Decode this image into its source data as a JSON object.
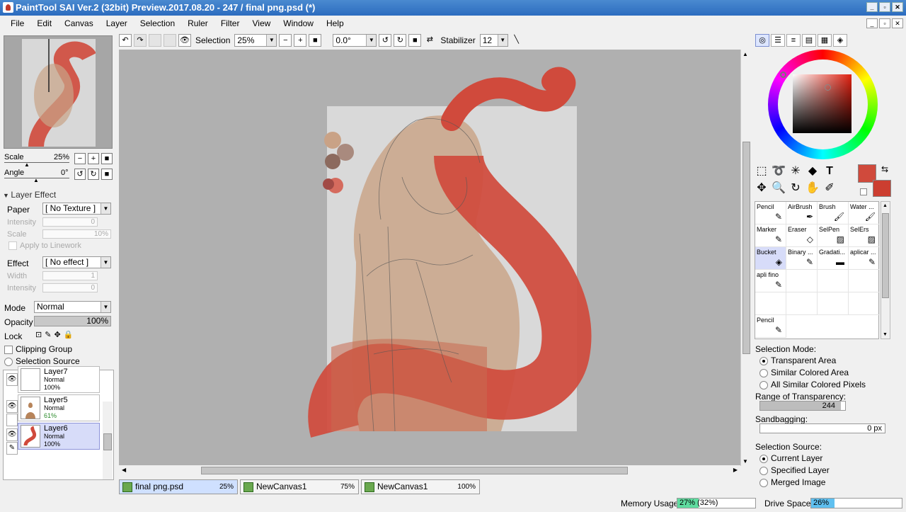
{
  "title": "PaintTool SAI Ver.2 (32bit) Preview.2017.08.20 - 247 / final png.psd (*)",
  "menu": [
    "File",
    "Edit",
    "Canvas",
    "Layer",
    "Selection",
    "Ruler",
    "Filter",
    "View",
    "Window",
    "Help"
  ],
  "toolbar": {
    "selection_label": "Selection",
    "zoom": "25%",
    "angle": "0.0°",
    "stabilizer_label": "Stabilizer",
    "stabilizer": "12"
  },
  "navigator": {
    "scale_label": "Scale",
    "scale": "25%",
    "angle_label": "Angle",
    "angle": "0°"
  },
  "layer_effect": {
    "header": "Layer Effect",
    "paper_label": "Paper",
    "paper": "[ No Texture ]",
    "intensity_label": "Intensity",
    "intensity": "0",
    "scale_label": "Scale",
    "scale": "10%",
    "apply_label": "Apply to Linework",
    "effect_label": "Effect",
    "effect": "[ No effect ]",
    "width_label": "Width",
    "width": "1",
    "intensity2_label": "Intensity",
    "intensity2": "0"
  },
  "blend": {
    "mode_label": "Mode",
    "mode": "Normal",
    "opacity_label": "Opacity",
    "opacity": "100%",
    "lock_label": "Lock",
    "clipping_label": "Clipping Group",
    "selsource_label": "Selection Source"
  },
  "layers": [
    {
      "name": "Layer7",
      "mode": "Normal",
      "opacity": "100%"
    },
    {
      "name": "Layer5",
      "mode": "Normal",
      "opacity": "61%"
    },
    {
      "name": "Layer6",
      "mode": "Normal",
      "opacity": "100%"
    }
  ],
  "tabs": [
    {
      "name": "final png.psd",
      "pct": "25%"
    },
    {
      "name": "NewCanvas1",
      "pct": "75%"
    },
    {
      "name": "NewCanvas1",
      "pct": "100%"
    }
  ],
  "brushes": [
    [
      "Pencil",
      "AirBrush",
      "Brush",
      "Water ..."
    ],
    [
      "Marker",
      "Eraser",
      "SelPen",
      "SelErs"
    ],
    [
      "Bucket",
      "Binary ...",
      "Gradati...",
      "aplicar ..."
    ],
    [
      "apli fino",
      "",
      "",
      ""
    ],
    [
      "",
      "",
      "",
      ""
    ],
    [
      "Pencil",
      "",
      "",
      ""
    ]
  ],
  "bucket_options": {
    "mode_label": "Selection Mode:",
    "opt1": "Transparent Area",
    "opt2": "Similar Colored Area",
    "opt3": "All Similar Colored Pixels",
    "range_label": "Range of Transparency:",
    "range": "244",
    "sand_label": "Sandbagging:",
    "sand": "0 px",
    "source_label": "Selection Source:",
    "src1": "Current Layer",
    "src2": "Specified Layer",
    "src3": "Merged Image"
  },
  "status": {
    "memory_label": "Memory Usage",
    "memory": "27% (32%)",
    "memory_fraction": 0.27,
    "drive_label": "Drive Space",
    "drive": "26%",
    "drive_fraction": 0.26
  },
  "colors": {
    "primary": "#d04a3c",
    "secondary": "#cc3e30",
    "accent": "#2c6cbf"
  }
}
